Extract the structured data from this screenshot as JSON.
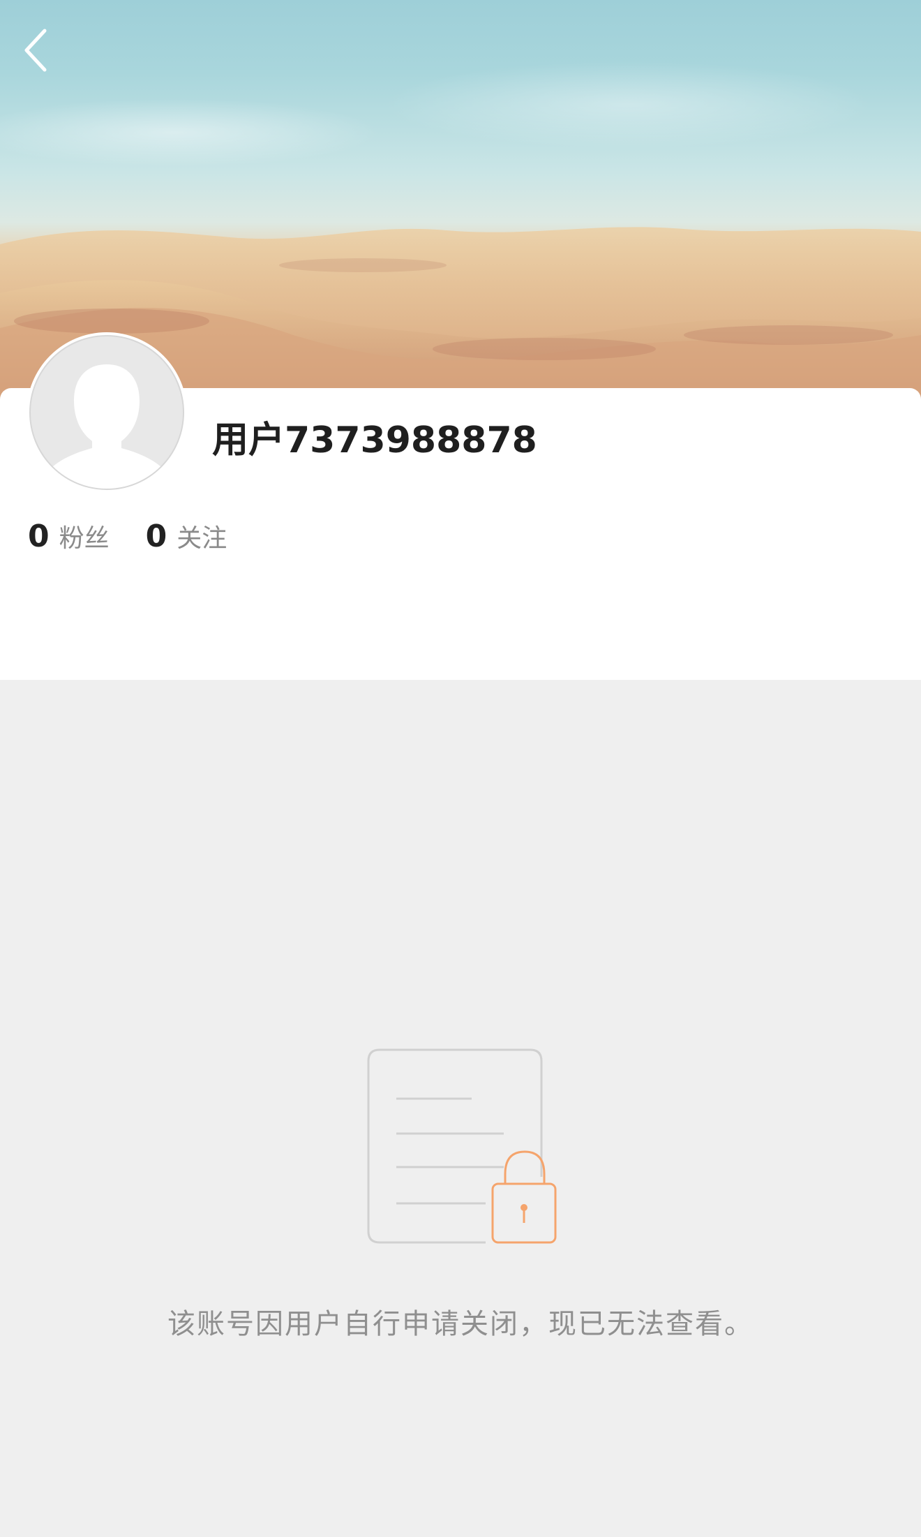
{
  "header": {
    "back_icon": "chevron-left-icon",
    "cover_image": "beach-sand-cover"
  },
  "profile": {
    "avatar": "default-avatar-silhouette",
    "username": "用户7373988878",
    "stats": [
      {
        "value": "0",
        "label": "粉丝"
      },
      {
        "value": "0",
        "label": "关注"
      }
    ]
  },
  "closed_notice": {
    "icon": "document-lock-icon",
    "message": "该账号因用户自行申请关闭，现已无法查看。"
  },
  "colors": {
    "page_background": "#efefef",
    "card_background": "#ffffff",
    "lock_accent": "#f5a46c",
    "document_stroke": "#d0d0d0",
    "username_text": "#1f1f1f",
    "secondary_text": "#8a8a8a"
  }
}
